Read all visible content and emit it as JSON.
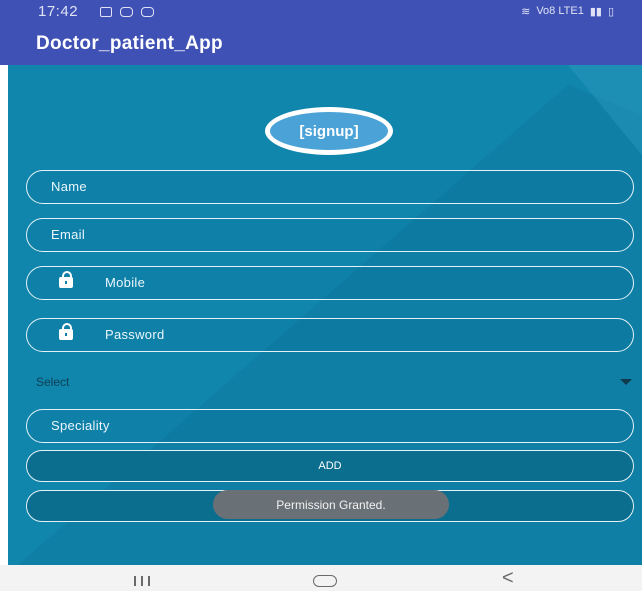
{
  "status_bar": {
    "time": "17:42",
    "left_icons": [
      "gallery-icon",
      "download-icon",
      "message-icon"
    ],
    "right_text": "Vo8 LTE1",
    "right_icons": [
      "wifi-icon",
      "signal-icon",
      "battery-icon"
    ]
  },
  "app_bar": {
    "title": "Doctor_patient_App",
    "color": "#3f51b5"
  },
  "logo": {
    "text": "[signup]"
  },
  "form": {
    "name_placeholder": "Name",
    "email_placeholder": "Email",
    "mobile_placeholder": "Mobile",
    "password_placeholder": "Password",
    "select_value": "Select",
    "speciality_placeholder": "Speciality",
    "add_label": "ADD"
  },
  "toast": {
    "text": "Permission Granted."
  },
  "nav_bar": {
    "icons": [
      "recents-icon",
      "home-icon",
      "back-icon"
    ]
  },
  "colors": {
    "background": "#1186ad",
    "accent": "#3f51b5",
    "button": "#0b6e8e",
    "toast": "#6a7176"
  }
}
